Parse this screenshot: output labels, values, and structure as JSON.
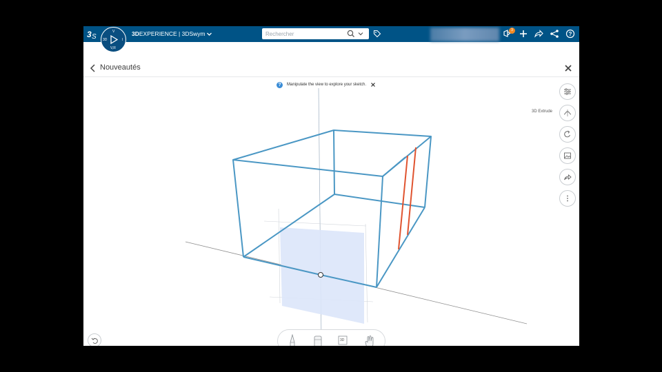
{
  "app": {
    "brand_bold": "3D",
    "brand_rest": "EXPERIENCE | 3DSwym",
    "compass_labels": {
      "top": "V",
      "left": "3D",
      "right": "I",
      "bottom": "V,R"
    }
  },
  "search": {
    "placeholder": "Rechercher"
  },
  "notifications": {
    "count": "3"
  },
  "page": {
    "title": "Nouveautés"
  },
  "tip": {
    "icon": "?",
    "text": "Manipulate the view to explore your sketch."
  },
  "tools": {
    "extrude_label": "3D Extrude"
  },
  "bottom_tools": {
    "view3d_label": "3D"
  },
  "colors": {
    "topbar": "#005386",
    "sketch_blue": "#4a97c4",
    "sketch_red": "#e0532f",
    "plane_fill": "#dbe6fa",
    "axis": "#9a9a9a"
  },
  "icons": [
    "3ds-logo-icon",
    "compass-icon",
    "chevron-down-icon",
    "search-icon",
    "tag-icon",
    "notification-icon",
    "plus-icon",
    "share-icon",
    "network-icon",
    "help-icon",
    "back-icon",
    "close-icon",
    "info-icon",
    "sliders-icon",
    "extrude-icon",
    "rotate-icon",
    "image-icon",
    "export-icon",
    "more-icon",
    "pen-icon",
    "eraser-icon",
    "view3d-icon",
    "hand-icon",
    "undo-icon"
  ]
}
